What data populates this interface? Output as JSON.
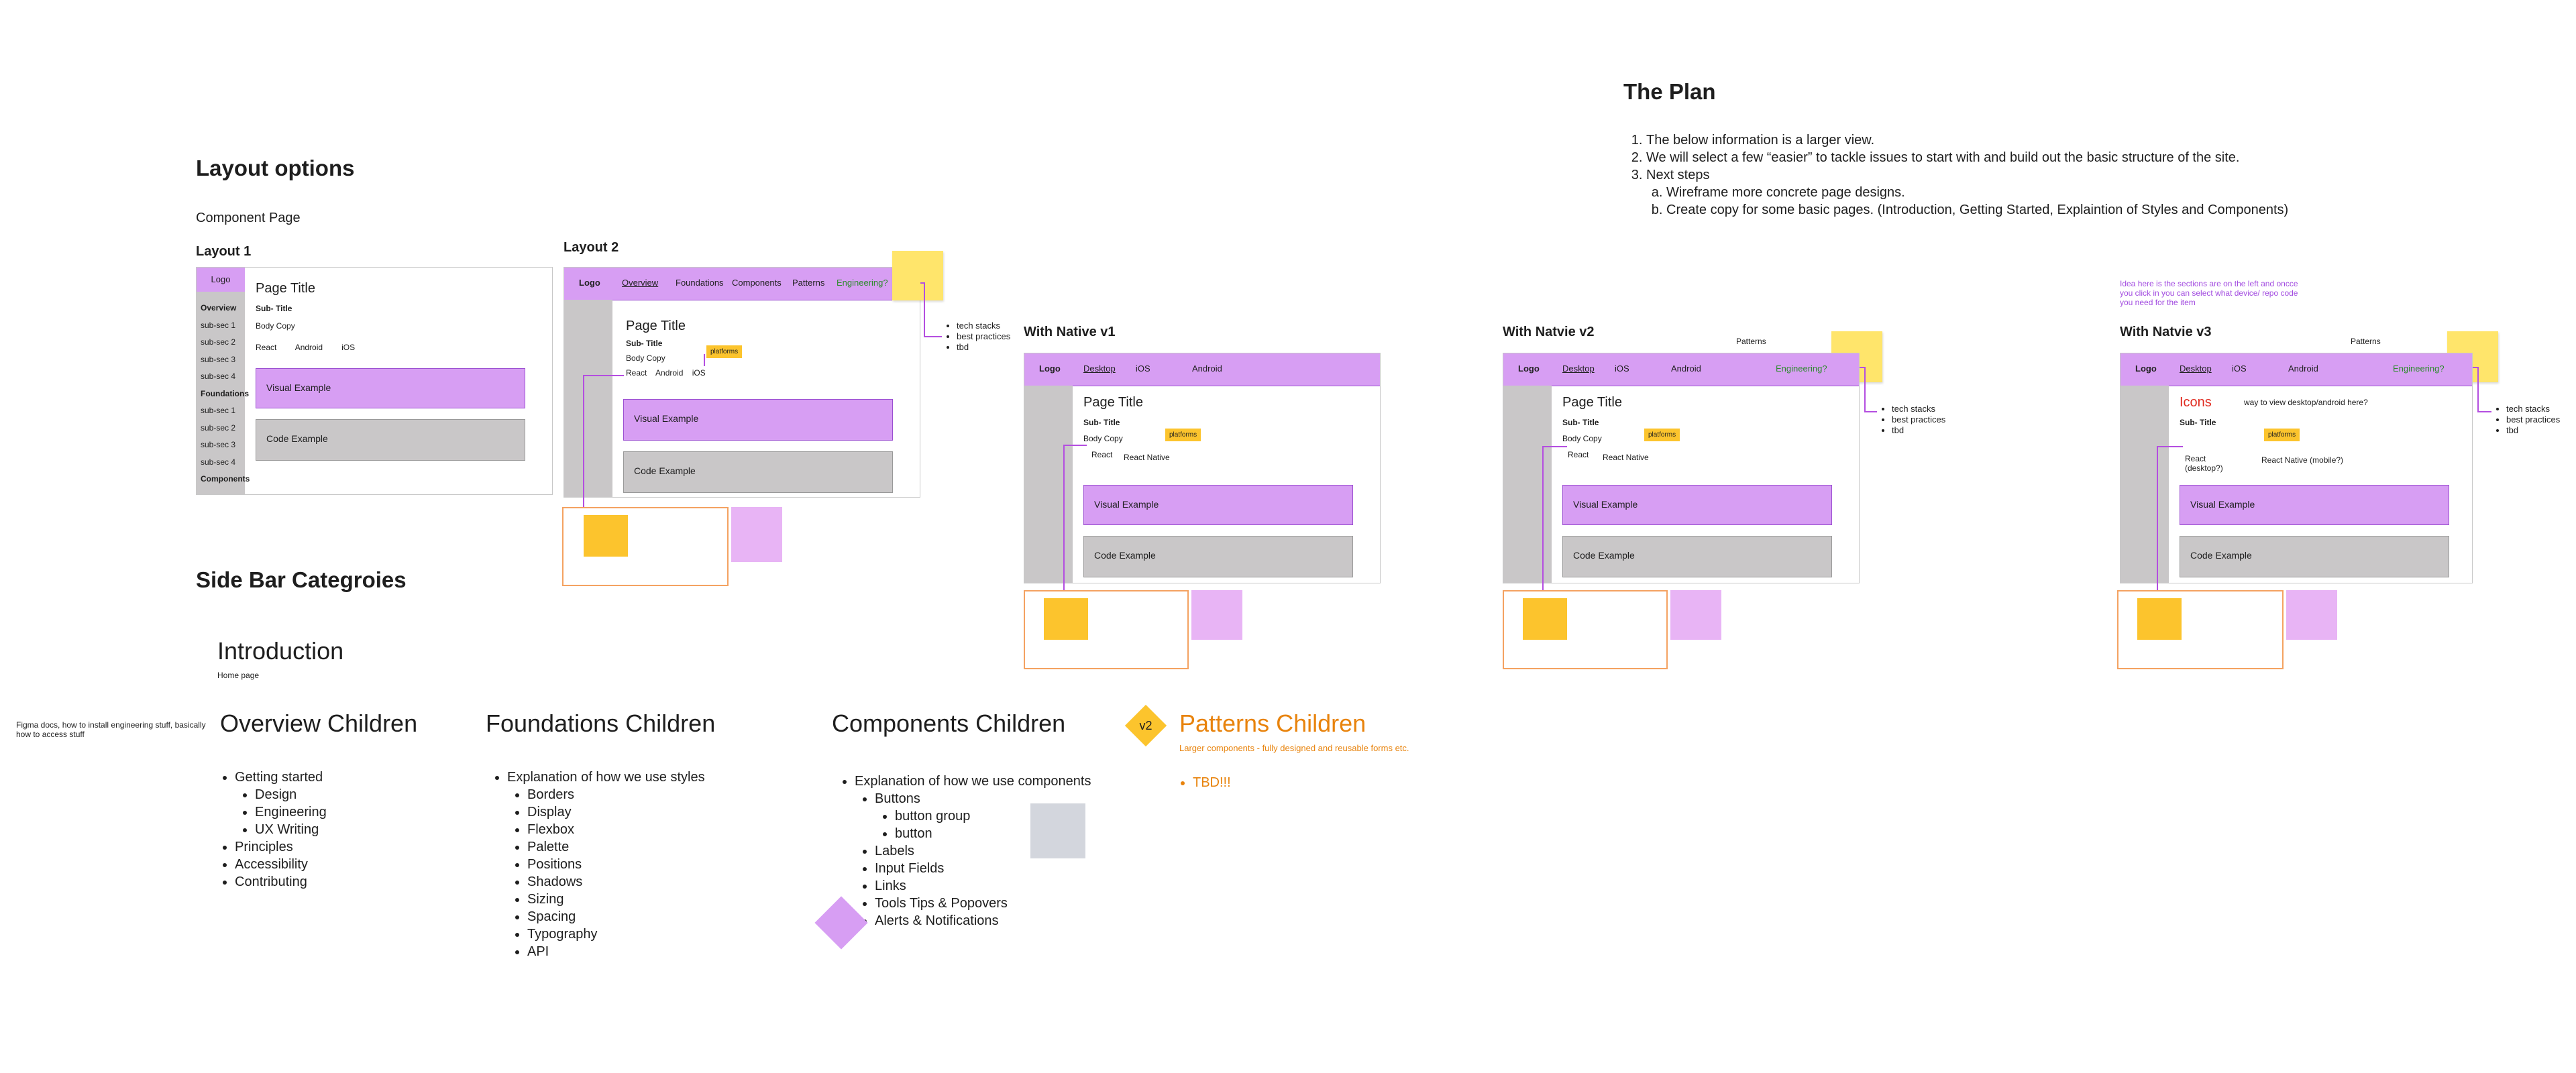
{
  "plan": {
    "title": "The Plan",
    "items": [
      "The below information is a larger view.",
      "We will select a few “easier” to tackle issues to start with and build out the basic structure of the site.",
      "Next steps"
    ],
    "subitems": [
      "Wireframe more concrete page designs.",
      "Create copy for some basic pages. (Introduction, Getting Started, Explaintion of Styles and Components)"
    ]
  },
  "layout_options": {
    "title": "Layout options",
    "subtitle": "Component Page",
    "layout1": {
      "label": "Layout 1",
      "logo": "Logo",
      "sidebar": [
        "Overview",
        "sub-sec 1",
        "sub-sec 2",
        "sub-sec 3",
        "sub-sec 4",
        "Foundations",
        "sub-sec 1",
        "sub-sec 2",
        "sub-sec 3",
        "sub-sec 4",
        "Components"
      ],
      "page_title": "Page Title",
      "sub_title": "Sub- Title",
      "body_copy": "Body Copy",
      "tabs": [
        "React",
        "Android",
        "iOS"
      ],
      "visual": "Visual Example",
      "code": "Code Example"
    },
    "layout2": {
      "label": "Layout 2",
      "logo": "Logo",
      "nav": [
        "Overview",
        "Foundations",
        "Components",
        "Patterns",
        "Engineering?"
      ],
      "page_title": "Page Title",
      "sub_title": "Sub- Title",
      "body_copy": "Body Copy",
      "tabs": [
        "React",
        "Android",
        "iOS"
      ],
      "platforms_tag": "platforms",
      "visual": "Visual Example",
      "code": "Code Example",
      "bullets": [
        "tech stacks",
        "best practices",
        "tbd"
      ]
    }
  },
  "native_v1": {
    "label": "With Native v1",
    "logo": "Logo",
    "nav": [
      "Desktop",
      "iOS",
      "Android"
    ],
    "page_title": "Page Title",
    "sub_title": "Sub- Title",
    "body_copy": "Body Copy",
    "tabs": [
      "React",
      "React Native"
    ],
    "platforms_tag": "platforms",
    "visual": "Visual Example",
    "code": "Code Example"
  },
  "native_v2": {
    "label": "With Natvie v2",
    "patterns": "Patterns",
    "logo": "Logo",
    "nav": [
      "Desktop",
      "iOS",
      "Android",
      "Engineering?"
    ],
    "page_title": "Page Title",
    "sub_title": "Sub- Title",
    "body_copy": "Body Copy",
    "tabs": [
      "React",
      "React Native"
    ],
    "platforms_tag": "platforms",
    "visual": "Visual Example",
    "code": "Code Example",
    "bullets": [
      "tech stacks",
      "best practices",
      "tbd"
    ]
  },
  "native_v3": {
    "label": "With Natvie v3",
    "idea_note": "Idea here is the sections are on the left and oncce you click in you can select what device/ repo code you need for the item",
    "patterns": "Patterns",
    "logo": "Logo",
    "nav": [
      "Desktop",
      "iOS",
      "Android",
      "Engineering?"
    ],
    "page_title": "Icons",
    "question": "way to view desktop/android here?",
    "sub_title": "Sub- Title",
    "tabs": [
      "React (desktop?)",
      "React Native (mobile?)"
    ],
    "platforms_tag": "platforms",
    "visual": "Visual Example",
    "code": "Code Example",
    "bullets": [
      "tech stacks",
      "best practices",
      "tbd"
    ]
  },
  "sidebar_categories": {
    "title": "Side Bar Categroies",
    "introduction": "Introduction",
    "home_page": "Home page",
    "figma_note": "Figma docs, how to install engineering stuff, basically how to access stuff",
    "overview": {
      "title": "Overview Children",
      "items": [
        "Getting started",
        "Principles",
        "Accessibility",
        "Contributing"
      ],
      "getting_started_children": [
        "Design",
        "Engineering",
        "UX Writing"
      ]
    },
    "foundations": {
      "title": "Foundations Children",
      "intro": "Explanation of how we use styles",
      "items": [
        "Borders",
        "Display",
        "Flexbox",
        "Palette",
        "Positions",
        "Shadows",
        "Sizing",
        "Spacing",
        "Typography",
        "API"
      ]
    },
    "components": {
      "title": "Components Children",
      "intro": "Explanation of how we use components",
      "buttons": "Buttons",
      "button_children": [
        "button group",
        "button"
      ],
      "items": [
        "Labels",
        "Input Fields",
        "Links",
        "Tools Tips & Popovers",
        "Alerts & Notifications"
      ]
    },
    "patterns": {
      "badge": "v2",
      "title": "Patterns Children",
      "subtitle": "Larger components - fully designed and reusable forms etc.",
      "items": [
        "TBD!!!"
      ]
    }
  },
  "colors": {
    "purple_bar": "#d79ef3",
    "gray_block": "#c9c7c8",
    "sticky_yellow": "#ffe56b",
    "sticky_orange": "#fcc42d",
    "patterns_orange": "#e8830c",
    "connector_purple": "#b44ee0"
  }
}
